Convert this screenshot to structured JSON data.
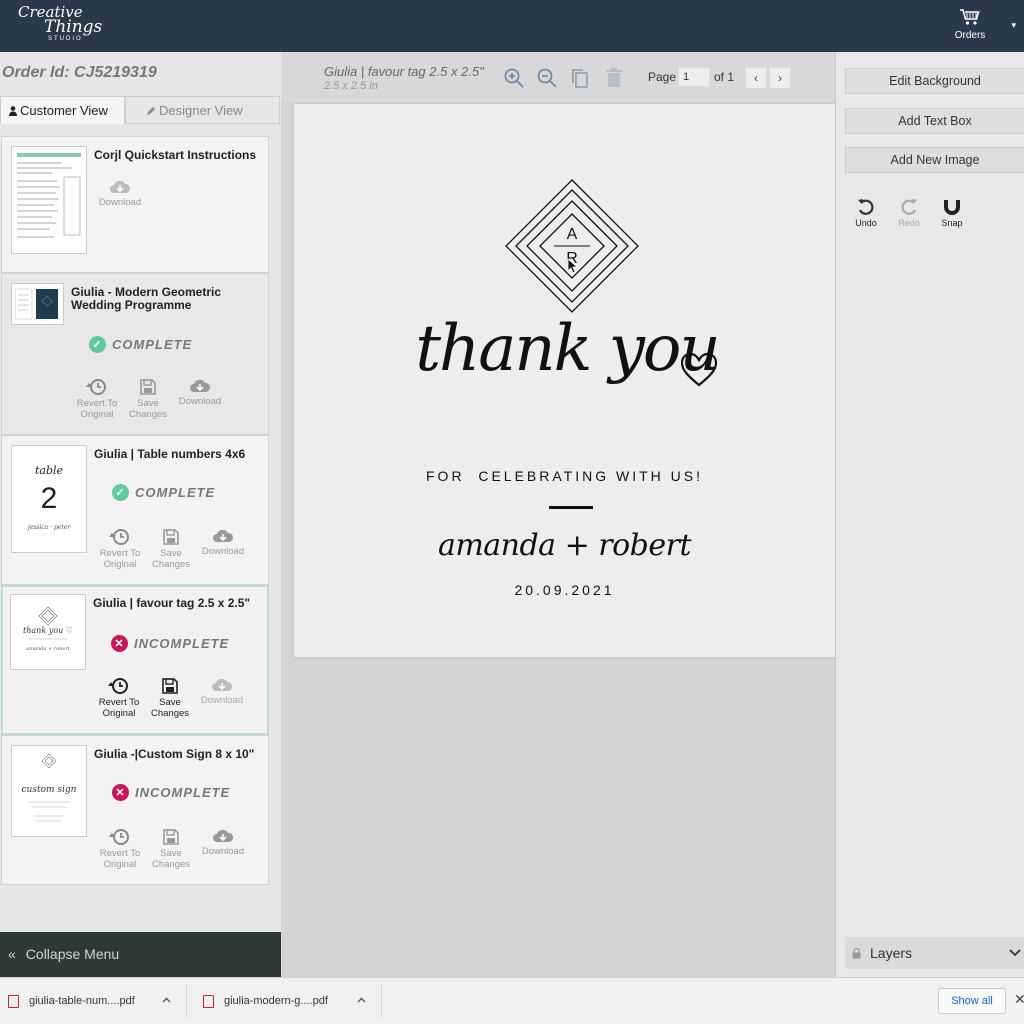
{
  "brand": {
    "line1": "Creative",
    "line2": "Things",
    "line3": "STUDIO"
  },
  "header": {
    "orders_label": "Orders",
    "cart_icon": "cart-icon",
    "caret": "▾"
  },
  "order": {
    "id_label": "Order Id: CJ5219319"
  },
  "tabs": {
    "customer": "Customer View",
    "designer": "Designer View"
  },
  "actions": {
    "revert": "Revert To Original",
    "save": "Save Changes",
    "download": "Download"
  },
  "items": [
    {
      "title": "Corjl Quickstart Instructions",
      "download": "Download"
    },
    {
      "title": "Giulia - Modern Geometric Wedding Programme",
      "status": "COMPLETE"
    },
    {
      "title": "Giulia | Table numbers 4x6",
      "status": "COMPLETE",
      "thumb_word": "table",
      "thumb_number": "2",
      "thumb_names": "jessica · peter"
    },
    {
      "title": "Giulia | favour tag 2.5 x 2.5\"",
      "status": "INCOMPLETE"
    },
    {
      "title": "Giulia -|Custom Sign 8 x 10\"",
      "status": "INCOMPLETE"
    }
  ],
  "collapse_label": "Collapse Menu",
  "editor": {
    "doc_title": "Giulia | favour tag 2.5 x 2.5\"",
    "doc_size": "2.5 x 2.5 in",
    "page_label": "Page",
    "page_value": "1",
    "page_of": "of 1",
    "prev": "‹",
    "next": "›"
  },
  "design": {
    "monogram_top": "A",
    "monogram_bottom": "R",
    "script_main": "thank you",
    "caption": "FOR  CELEBRATING WITH US!",
    "names": "amanda + robert",
    "date": "20.09.2021"
  },
  "right_panel": {
    "edit_background": "Edit Background",
    "add_text_box": "Add Text Box",
    "add_new_image": "Add New Image",
    "undo": "Undo",
    "redo": "Redo",
    "snap": "Snap",
    "layers": "Layers"
  },
  "downloads": {
    "file1": "giulia-table-num....pdf",
    "file2": "giulia-modern-g....pdf",
    "show_all": "Show all",
    "close": "✕"
  },
  "colors": {
    "topbar": "#2b3a4a",
    "complete": "#5fcb9b",
    "incomplete": "#c8185b",
    "collapse_bar": "#2f3a36",
    "link": "#1a62d1"
  }
}
